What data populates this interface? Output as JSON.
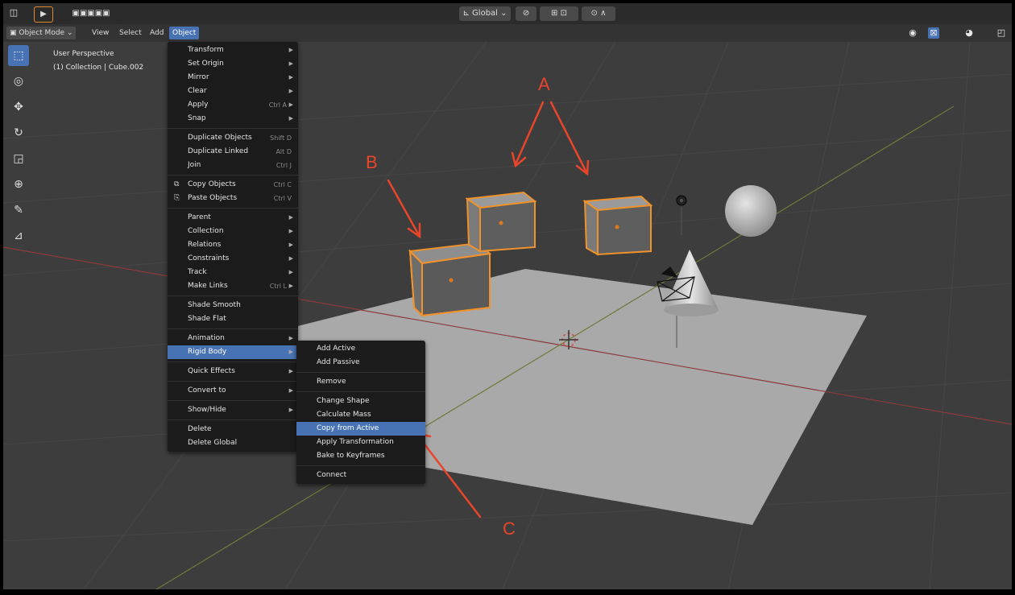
{
  "header": {
    "transform_orientation": "Global"
  },
  "mode_bar": {
    "mode": "Object Mode",
    "menus": [
      "View",
      "Select",
      "Add",
      "Object"
    ],
    "active_menu": "Object"
  },
  "viewport_info": {
    "perspective": "User Perspective",
    "collection": "(1) Collection | Cube.002"
  },
  "object_menu": {
    "items": [
      {
        "label": "Transform",
        "submenu": true
      },
      {
        "label": "Set Origin",
        "submenu": true
      },
      {
        "label": "Mirror",
        "submenu": true
      },
      {
        "label": "Clear",
        "submenu": true
      },
      {
        "label": "Apply",
        "shortcut": "Ctrl A",
        "submenu": true
      },
      {
        "label": "Snap",
        "submenu": true
      },
      {
        "separator": true
      },
      {
        "label": "Duplicate Objects",
        "shortcut": "Shift D"
      },
      {
        "label": "Duplicate Linked",
        "shortcut": "Alt D"
      },
      {
        "label": "Join",
        "shortcut": "Ctrl J"
      },
      {
        "separator": true
      },
      {
        "label": "Copy Objects",
        "shortcut": "Ctrl C",
        "icon": "copy-icon"
      },
      {
        "label": "Paste Objects",
        "shortcut": "Ctrl V",
        "icon": "paste-icon"
      },
      {
        "separator": true
      },
      {
        "label": "Parent",
        "submenu": true
      },
      {
        "label": "Collection",
        "submenu": true
      },
      {
        "label": "Relations",
        "submenu": true
      },
      {
        "label": "Constraints",
        "submenu": true
      },
      {
        "label": "Track",
        "submenu": true
      },
      {
        "label": "Make Links",
        "shortcut": "Ctrl L",
        "submenu": true
      },
      {
        "separator": true
      },
      {
        "label": "Shade Smooth"
      },
      {
        "label": "Shade Flat"
      },
      {
        "separator": true
      },
      {
        "label": "Animation",
        "submenu": true
      },
      {
        "label": "Rigid Body",
        "submenu": true,
        "highlighted": true
      },
      {
        "separator": true
      },
      {
        "label": "Quick Effects",
        "submenu": true
      },
      {
        "separator": true
      },
      {
        "label": "Convert to",
        "submenu": true
      },
      {
        "separator": true
      },
      {
        "label": "Show/Hide",
        "submenu": true
      },
      {
        "separator": true
      },
      {
        "label": "Delete"
      },
      {
        "label": "Delete Global"
      }
    ]
  },
  "rigid_body_menu": {
    "items": [
      {
        "label": "Add Active"
      },
      {
        "label": "Add Passive"
      },
      {
        "separator": true
      },
      {
        "label": "Remove"
      },
      {
        "separator": true
      },
      {
        "label": "Change Shape"
      },
      {
        "label": "Calculate Mass"
      },
      {
        "label": "Copy from Active",
        "highlighted": true
      },
      {
        "label": "Apply Transformation"
      },
      {
        "label": "Bake to Keyframes"
      },
      {
        "separator": true
      },
      {
        "label": "Connect"
      }
    ]
  },
  "annotations": {
    "a": "A",
    "b": "B",
    "c": "C"
  },
  "colors": {
    "accent": "#4772b3",
    "annotation": "#e8452b",
    "selection": "#f0922c"
  }
}
